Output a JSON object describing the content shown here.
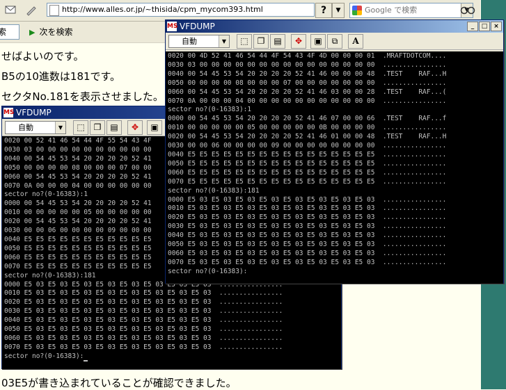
{
  "browser": {
    "url": "http://www.alles.or.jp/~thisida/cpm_mycom393.html",
    "help_glyph": "?",
    "search_placeholder": "Google で検索",
    "find_text": "索",
    "find_next_label": "次を検索"
  },
  "page": {
    "line1": "せばよいのです。",
    "line2": "B5の10進数は181です。",
    "line3": "セクタNo.181を表示させました。",
    "bottom_line": "03E5が書き込まれていることが確認できました。"
  },
  "window_back": {
    "title": "VFDUMP",
    "font": "自動",
    "lines": [
      "0020 00 52 41 46 54 44 4F 55 54 43 4F",
      "0030 03 00 00 00 00 00 00 00 00 00 00",
      "0040 00 54 45 53 54 20 20 20 20 52 41",
      "0050 00 00 00 00 08 00 00 00 07 00 00",
      "0060 00 54 45 53 54 20 20 20 20 52 41",
      "0070 0A 00 00 00 04 00 00 00 00 00 00",
      "sector no?(0-16383):1",
      "0000 00 54 45 53 54 20 20 20 20 52 41",
      "0010 00 00 00 00 00 05 00 00 00 00 00",
      "0020 00 54 45 53 54 20 20 20 20 52 41",
      "0030 00 00 06 00 00 00 00 09 00 00 00",
      "0040 E5 E5 E5 E5 E5 E5 E5 E5 E5 E5 E5",
      "0050 E5 E5 E5 E5 E5 E5 E5 E5 E5 E5 E5",
      "0060 E5 E5 E5 E5 E5 E5 E5 E5 E5 E5 E5",
      "0070 E5 E5 E5 E5 E5 E5 E5 E5 E5 E5 E5",
      "sector no?(0-16383):181",
      "0000 E5 03 E5 03 E5 03 E5 03 E5 03 E5 03 E5 03 E5 03  ................",
      "0010 E5 03 E5 03 E5 03 E5 03 E5 03 E5 03 E5 03 E5 03  ................",
      "0020 E5 03 E5 03 E5 03 E5 03 E5 03 E5 03 E5 03 E5 03  ................",
      "0030 E5 03 E5 03 E5 03 E5 03 E5 03 E5 03 E5 03 E5 03  ................",
      "0040 E5 03 E5 03 E5 03 E5 03 E5 03 E5 03 E5 03 E5 03  ................",
      "0050 E5 03 E5 03 E5 03 E5 03 E5 03 E5 03 E5 03 E5 03  ................",
      "0060 E5 03 E5 03 E5 03 E5 03 E5 03 E5 03 E5 03 E5 03  ................",
      "0070 E5 03 E5 03 E5 03 E5 03 E5 03 E5 03 E5 03 E5 03  ................"
    ],
    "prompt": "sector no?(0-16383):"
  },
  "window_front": {
    "title": "VFDUMP",
    "font": "自動",
    "text_tool": "A",
    "lines": [
      "0020 00 4D 52 41 46 54 44 4F 54 43 4F 4D 00 00 00 01  .MRAFTDOTCOM....",
      "0030 03 00 00 00 00 00 00 00 00 00 00 00 00 00 00 00  ................",
      "0040 00 54 45 53 54 20 20 20 20 52 41 46 00 00 00 48  .TEST    RAF...H",
      "0050 00 00 00 00 08 00 00 00 07 00 00 00 00 00 00 00  ................",
      "0060 00 54 45 53 54 20 20 20 20 52 41 46 03 00 00 28  .TEST    RAF...(",
      "0070 0A 00 00 00 04 00 00 00 00 00 00 00 00 00 00 00  ................",
      "sector no?(0-16383):1",
      "0000 00 54 45 53 54 20 20 20 20 52 41 46 07 00 00 66  .TEST    RAF...f",
      "0010 00 00 00 00 00 05 00 00 00 00 00 0B 00 00 00 00  ................",
      "0020 00 54 45 53 54 20 20 20 20 52 41 46 01 00 00 48  .TEST    RAF...H",
      "0030 00 00 06 00 00 00 00 09 00 00 00 00 00 00 00 00  ................",
      "0040 E5 E5 E5 E5 E5 E5 E5 E5 E5 E5 E5 E5 E5 E5 E5 E5  ................",
      "0050 E5 E5 E5 E5 E5 E5 E5 E5 E5 E5 E5 E5 E5 E5 E5 E5  ................",
      "0060 E5 E5 E5 E5 E5 E5 E5 E5 E5 E5 E5 E5 E5 E5 E5 E5  ................",
      "0070 E5 E5 E5 E5 E5 E5 E5 E5 E5 E5 E5 E5 E5 E5 E5 E5  ................",
      "sector no?(0-16383):181",
      "0000 E5 03 E5 03 E5 03 E5 03 E5 03 E5 03 E5 03 E5 03  ................",
      "0010 E5 03 E5 03 E5 03 E5 03 E5 03 E5 03 E5 03 E5 03  ................",
      "0020 E5 03 E5 03 E5 03 E5 03 E5 03 E5 03 E5 03 E5 03  ................",
      "0030 E5 03 E5 03 E5 03 E5 03 E5 03 E5 03 E5 03 E5 03  ................",
      "0040 E5 03 E5 03 E5 03 E5 03 E5 03 E5 03 E5 03 E5 03  ................",
      "0050 E5 03 E5 03 E5 03 E5 03 E5 03 E5 03 E5 03 E5 03  ................",
      "0060 E5 03 E5 03 E5 03 E5 03 E5 03 E5 03 E5 03 E5 03  ................",
      "0070 E5 03 E5 03 E5 03 E5 03 E5 03 E5 03 E5 03 E5 03  ................",
      "sector no?(0-16383):"
    ]
  }
}
